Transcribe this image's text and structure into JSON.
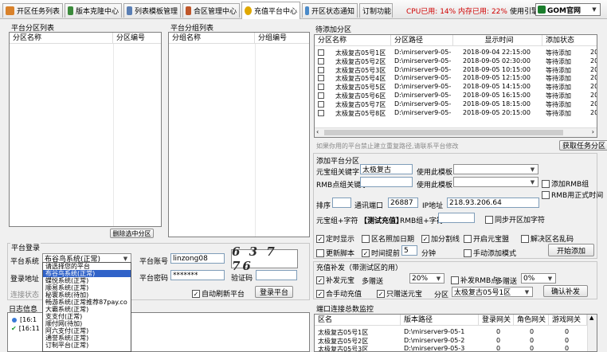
{
  "tabs": [
    {
      "label": "开区任务列表",
      "color": "#d9822b"
    },
    {
      "label": "版本克隆中心",
      "color": "#3b8a3b"
    },
    {
      "label": "列表模板管理",
      "color": "#5a7fb5"
    },
    {
      "label": "合区管理中心",
      "color": "#c0562a"
    },
    {
      "label": "充值平台中心",
      "color": "#e0a800"
    },
    {
      "label": "开区状态通知",
      "color": "#4a8ac9"
    },
    {
      "label": "订制功能",
      "color": ""
    }
  ],
  "status": {
    "cpu": "CPU已用: 14% 内存已用: 22%",
    "engine_label": "使用引擎",
    "engine_value": "GOM官网"
  },
  "platform_list": {
    "title": "平台分区列表",
    "col1": "分区名称",
    "col2": "分区编号",
    "delete_button": "删除选中分区"
  },
  "group_list": {
    "title": "平台分组列表",
    "col1": "分组名称",
    "col2": "分组编号"
  },
  "pending": {
    "title": "待添加分区",
    "columns": [
      "分区名称",
      "分区路径",
      "显示时间",
      "添加状态"
    ],
    "rows": [
      {
        "name": "太极复古05号1区",
        "path": "D:\\mirserver9-05-",
        "time": "2018-09-04 22:15:00",
        "status": "等待添加",
        "extra": "20"
      },
      {
        "name": "太极复古05号2区",
        "path": "D:\\mirserver9-05-",
        "time": "2018-09-05 02:30:00",
        "status": "等待添加",
        "extra": "20"
      },
      {
        "name": "太极复古05号3区",
        "path": "D:\\mirserver9-05-",
        "time": "2018-09-05 10:15:00",
        "status": "等待添加",
        "extra": "20"
      },
      {
        "name": "太极复古05号4区",
        "path": "D:\\mirserver9-05-",
        "time": "2018-09-05 12:15:00",
        "status": "等待添加",
        "extra": "20"
      },
      {
        "name": "太极复古05号5区",
        "path": "D:\\mirserver9-05-",
        "time": "2018-09-05 14:15:00",
        "status": "等待添加",
        "extra": "20"
      },
      {
        "name": "太极复古05号6区",
        "path": "D:\\mirserver9-05-",
        "time": "2018-09-05 16:15:00",
        "status": "等待添加",
        "extra": "20"
      },
      {
        "name": "太极复古05号7区",
        "path": "D:\\mirserver9-05-",
        "time": "2018-09-05 18:15:00",
        "status": "等待添加",
        "extra": "20"
      },
      {
        "name": "太极复古05号8区",
        "path": "D:\\mirserver9-05-",
        "time": "2018-09-05 20:15:00",
        "status": "等待添加",
        "extra": "20"
      }
    ],
    "hint": "如果你用的平台禁止建立重复路径,请联系平台修改",
    "fetch_button": "获取任务分区"
  },
  "add_partition": {
    "title": "添加平台分区",
    "keyword_label": "元宝组关键字",
    "keyword_value": "太极复古",
    "template_label1": "使用此模板",
    "rmb_keyword_label": "RMB点组关键字",
    "template_label2": "使用此模板",
    "add_rmb_group": "添加RMB组",
    "rmb_formal_time": "RMB用正式时间",
    "sort_label": "排序",
    "port_label": "通讯端口",
    "port_value": "26887",
    "ip_label": "IP地址",
    "ip_value": "218.93.206.64",
    "ingot_char_label": "元宝组+字符",
    "test_recharge": "【测试充值】",
    "rmb_char_label": "RMB组+字符",
    "sync_chars": "同步开区加字符",
    "timed_show": "定时显示",
    "name_date": "区名照加日期",
    "add_bonus": "加分割线",
    "open_ingot": "开启元宝盟",
    "merge_name": "解决区名乱码",
    "update_script": "更新脚本",
    "time_ahead": "时间提前",
    "ahead_value": "5",
    "minute": "分钟",
    "manual_mode": "手动添加模式",
    "start_add_button": "开始添加"
  },
  "recharge": {
    "title": "充值补发（带测试区的用）",
    "reissue_ingot": "补发元宝",
    "multi_label": "多赠送",
    "multi_value": "20%",
    "reissue_rmb": "补发RMB点",
    "multi_label2": "多赠送",
    "multi_value2": "0%",
    "combined": "合手动充值",
    "only_gift": "只赠送元宝",
    "zone_label": "分区",
    "zone_value": "太极复古05号1区",
    "reissue_button": "确认补发"
  },
  "login": {
    "title": "平台登录",
    "system_label": "平台系统",
    "system_value": "布谷鸟系统(正常)",
    "account_label": "平台账号",
    "account_value": "linzong08",
    "password_label": "平台密码",
    "password_value": "*******",
    "captcha_label": "验证码",
    "captcha_text": "6 3 7 76",
    "addr_label": "登录地址",
    "status_label": "连接状态",
    "auto_refresh": "自动刷新平台",
    "login_button": "登录平台",
    "options": [
      "请选择您的平台",
      "布谷鸟系统(正常)",
      "蝶悦系统(正常)",
      "顺易系统(正常)",
      "秘寰系统(待加)",
      "畅游系统(正常推荐87pay.co",
      "大霸系统(正常)",
      "支支付(正常)",
      "顺付网(待加)",
      "阿六支付(正常)",
      "通誉系统(正常)",
      "订制平台(正常)"
    ]
  },
  "log": {
    "title": "日志信息",
    "line1": "[16:1",
    "line2": "[16:11"
  },
  "port_monitor": {
    "title": "端口连接总数监控",
    "columns": [
      "区名",
      "版本路径",
      "登录网关",
      "角色网关",
      "游戏网关"
    ],
    "rows": [
      {
        "name": "太极复古05号1区",
        "path": "D:\\mirserver9-05-1",
        "v1": "0",
        "v2": "0",
        "v3": "0"
      },
      {
        "name": "太极复古05号2区",
        "path": "D:\\mirserver9-05-2",
        "v1": "0",
        "v2": "0",
        "v3": "0"
      },
      {
        "name": "太极复古05号3区",
        "path": "D:\\mirserver9-05-3",
        "v1": "0",
        "v2": "0",
        "v3": "0"
      }
    ]
  }
}
